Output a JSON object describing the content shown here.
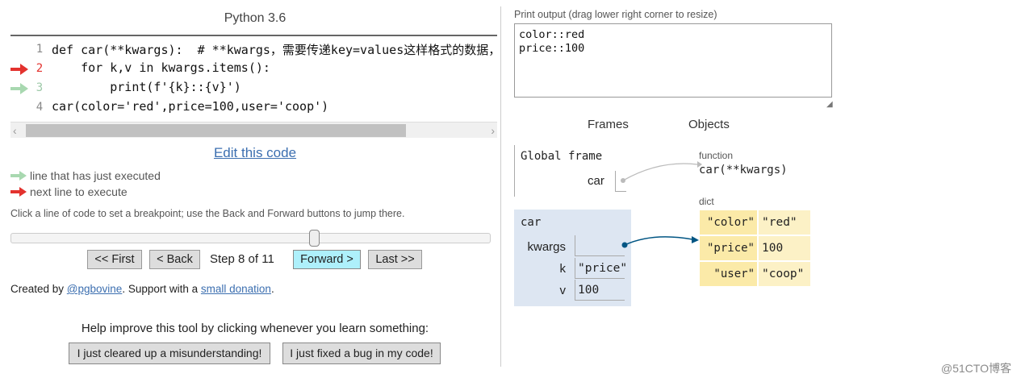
{
  "header": {
    "language": "Python 3.6"
  },
  "code": {
    "lines": [
      {
        "num": "1",
        "text": "def car(**kwargs):  # **kwargs，需要传递key=values这样格式的数据，"
      },
      {
        "num": "2",
        "text": "    for k,v in kwargs.items():"
      },
      {
        "num": "3",
        "text": "        print(f'{k}::{v}')"
      },
      {
        "num": "4",
        "text": "car(color='red',price=100,user='coop')"
      }
    ],
    "next_line": "2",
    "prev_line": "3",
    "scroll_left": "‹",
    "scroll_right": "›"
  },
  "edit_link": "Edit this code",
  "legend": {
    "prev": "line that has just executed",
    "next": "next line to execute"
  },
  "hint": "Click a line of code to set a breakpoint; use the Back and Forward buttons to jump there.",
  "navigation": {
    "first": "<< First",
    "back": "< Back",
    "step": "Step 8 of 11",
    "forward": "Forward >",
    "last": "Last >>",
    "step_current": 8,
    "step_total": 11
  },
  "credit": {
    "prefix": "Created by ",
    "author": "@pgbovine",
    "middle": ". Support with a ",
    "donation": "small donation",
    "suffix": "."
  },
  "feedback": {
    "prompt": "Help improve this tool by clicking whenever you learn something:",
    "misunderstanding": "I just cleared up a misunderstanding!",
    "bugfix": "I just fixed a bug in my code!"
  },
  "output": {
    "label": "Print output (drag lower right corner to resize)",
    "text": "color::red\nprice::100"
  },
  "visualizer": {
    "frames_header": "Frames",
    "objects_header": "Objects",
    "global_frame": {
      "title": "Global frame",
      "var": "car"
    },
    "function_obj": {
      "type": "function",
      "signature": "car(**kwargs)"
    },
    "car_frame": {
      "title": "car",
      "vars": [
        {
          "name": "kwargs",
          "value": ""
        },
        {
          "name": "k",
          "value": "\"price\""
        },
        {
          "name": "v",
          "value": "100"
        }
      ]
    },
    "dict_obj": {
      "type": "dict",
      "entries": [
        {
          "key": "\"color\"",
          "value": "\"red\""
        },
        {
          "key": "\"price\"",
          "value": "100"
        },
        {
          "key": "\"user\"",
          "value": "\"coop\""
        }
      ]
    }
  },
  "colors": {
    "next_arrow": "#e3322e",
    "prev_arrow": "#a8d8b0",
    "forward_button": "#aef0fb",
    "frame_bg": "#dde6f2",
    "dict_key_bg": "#fbeaa8",
    "pointer": "#005583"
  },
  "watermark": "@51CTO博客"
}
